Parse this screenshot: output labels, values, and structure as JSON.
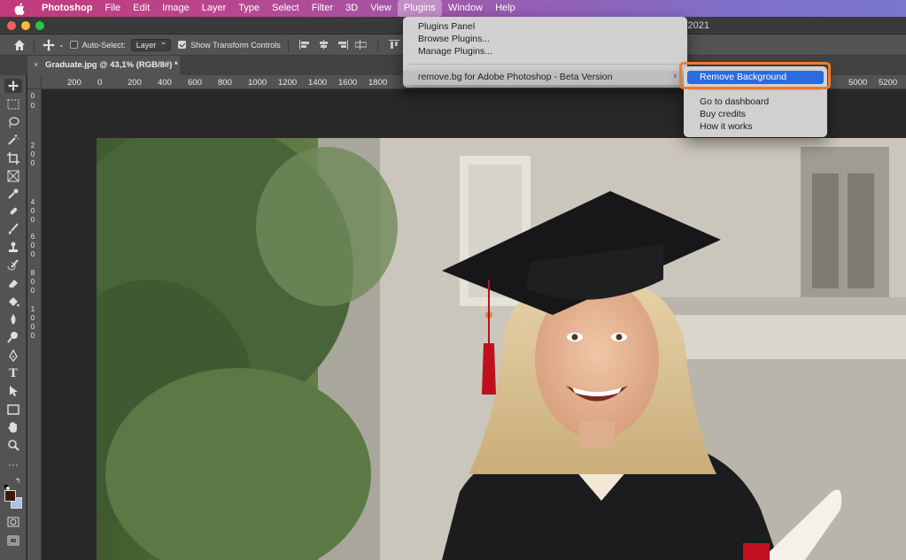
{
  "menubar": {
    "app_name": "Photoshop",
    "items": [
      "File",
      "Edit",
      "Image",
      "Layer",
      "Type",
      "Select",
      "Filter",
      "3D",
      "View",
      "Plugins",
      "Window",
      "Help"
    ]
  },
  "titlebar": {
    "title_fragment": "2021"
  },
  "options": {
    "auto_select_label": "Auto-Select:",
    "auto_select_value": "Layer",
    "show_transform_label": "Show Transform Controls"
  },
  "document": {
    "tab_title": "Graduate.jpg @ 43,1% (RGB/8#) *",
    "close_glyph": "×"
  },
  "ruler": {
    "h_labels": [
      "200",
      "0",
      "200",
      "400",
      "600",
      "800",
      "1000",
      "1200",
      "1400",
      "1600",
      "1800",
      "5000",
      "5200"
    ],
    "v_labels": [
      "0",
      "0",
      "2",
      "0",
      "0",
      "4",
      "0",
      "0",
      "6",
      "0",
      "0",
      "8",
      "0",
      "0",
      "1",
      "0",
      "0",
      "0"
    ]
  },
  "plugins_menu": {
    "items": [
      "Plugins Panel",
      "Browse Plugins...",
      "Manage Plugins..."
    ],
    "submenu_parent": "remove.bg for Adobe Photoshop - Beta Version",
    "submenu_arrow": "›"
  },
  "removebg_submenu": {
    "selected": "Remove Background",
    "items": [
      "Go to dashboard",
      "Buy credits",
      "How it works"
    ]
  },
  "colors": {
    "highlight": "#2a6be0",
    "callout": "#f07a2c",
    "menubar_start": "#c23a7a",
    "menubar_end": "#7a77cc"
  }
}
